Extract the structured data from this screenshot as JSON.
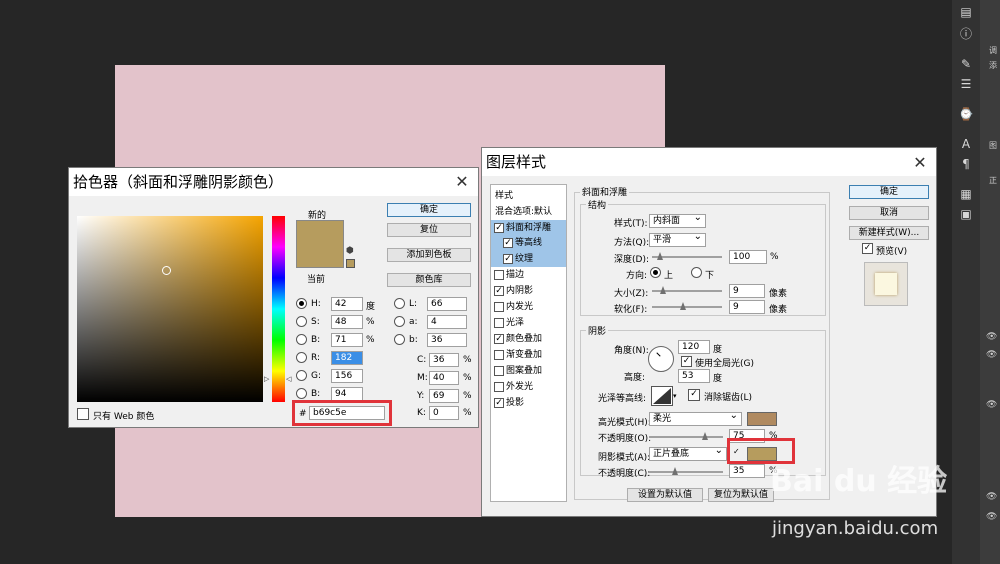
{
  "colors": {
    "accent": "#3c7fb1",
    "selected_color": "#b69c5e",
    "highlight": "#e0333a",
    "canvas": "#e3c3cb"
  },
  "picker": {
    "title": "拾色器（斜面和浮雕阴影颜色）",
    "new_label": "新的",
    "current_label": "当前",
    "ok": "确定",
    "reset": "复位",
    "add_swatch": "添加到色板",
    "color_library": "颜色库",
    "web_only": "只有 Web 颜色",
    "hex_symbol": "#",
    "hex": "b69c5e",
    "fields": {
      "H": {
        "label": "H:",
        "value": "42",
        "unit": "度"
      },
      "S": {
        "label": "S:",
        "value": "48",
        "unit": "%"
      },
      "B": {
        "label": "B:",
        "value": "71",
        "unit": "%"
      },
      "R": {
        "label": "R:",
        "value": "182"
      },
      "G": {
        "label": "G:",
        "value": "156"
      },
      "Bl": {
        "label": "B:",
        "value": "94"
      },
      "L": {
        "label": "L:",
        "value": "66"
      },
      "a": {
        "label": "a:",
        "value": "4"
      },
      "b": {
        "label": "b:",
        "value": "36"
      },
      "C": {
        "label": "C:",
        "value": "36",
        "unit": "%"
      },
      "M": {
        "label": "M:",
        "value": "40",
        "unit": "%"
      },
      "Y": {
        "label": "Y:",
        "value": "69",
        "unit": "%"
      },
      "K": {
        "label": "K:",
        "value": "0",
        "unit": "%"
      }
    }
  },
  "layer_style": {
    "title": "图层样式",
    "sidebar": {
      "header": "样式",
      "blend_options": "混合选项:默认",
      "items": [
        {
          "label": "斜面和浮雕",
          "checked": true
        },
        {
          "label": "等高线",
          "checked": true
        },
        {
          "label": "纹理",
          "checked": true
        },
        {
          "label": "描边",
          "checked": false
        },
        {
          "label": "内阴影",
          "checked": true
        },
        {
          "label": "内发光",
          "checked": false
        },
        {
          "label": "光泽",
          "checked": false
        },
        {
          "label": "颜色叠加",
          "checked": true
        },
        {
          "label": "渐变叠加",
          "checked": false
        },
        {
          "label": "图案叠加",
          "checked": false
        },
        {
          "label": "外发光",
          "checked": false
        },
        {
          "label": "投影",
          "checked": true
        }
      ]
    },
    "section_title": "斜面和浮雕",
    "structure": {
      "title": "结构",
      "style_label": "样式(T):",
      "style_value": "内斜面",
      "method_label": "方法(Q):",
      "method_value": "平滑",
      "depth_label": "深度(D):",
      "depth_value": "100",
      "depth_unit": "%",
      "direction_label": "方向:",
      "dir_up": "上",
      "dir_down": "下",
      "size_label": "大小(Z):",
      "size_value": "9",
      "size_unit": "像素",
      "soften_label": "软化(F):",
      "soften_value": "9",
      "soften_unit": "像素"
    },
    "shading": {
      "title": "阴影",
      "angle_label": "角度(N):",
      "angle_value": "120",
      "angle_unit": "度",
      "global_light": "使用全局光(G)",
      "altitude_label": "高度:",
      "altitude_value": "53",
      "altitude_unit": "度",
      "gloss_label": "光泽等高线:",
      "antialias": "消除锯齿(L)",
      "highlight_mode_label": "高光模式(H):",
      "highlight_mode": "柔光",
      "highlight_color": "#b08a60",
      "opacity1_label": "不透明度(O):",
      "opacity1_value": "75",
      "opacity1_unit": "%",
      "shadow_mode_label": "阴影模式(A):",
      "shadow_mode": "正片叠底",
      "shadow_color": "#b69c5e",
      "opacity2_label": "不透明度(C):",
      "opacity2_value": "35",
      "opacity2_unit": "%"
    },
    "make_default": "设置为默认值",
    "reset_default": "复位为默认值",
    "ok": "确定",
    "cancel": "取消",
    "new_style": "新建样式(W)...",
    "preview": "预览(V)"
  },
  "watermark": {
    "brand": "Bai du 经验",
    "url": "jingyan.baidu.com"
  },
  "right_panel": {
    "tab_text": "调",
    "text2": "添",
    "text3": "图",
    "text4": "正"
  }
}
